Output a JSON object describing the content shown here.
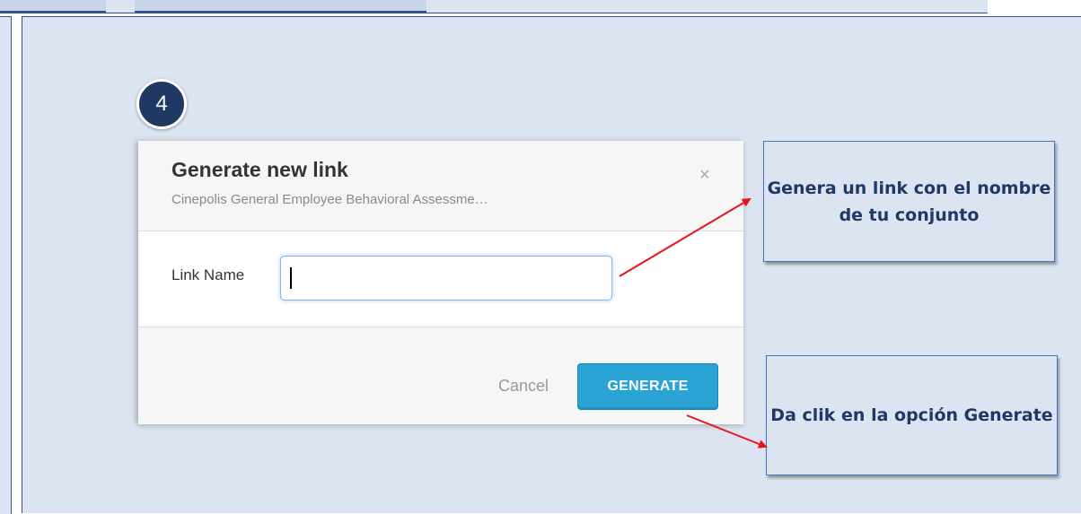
{
  "step_badge": "4",
  "dialog": {
    "title": "Generate new link",
    "subtitle": "Cinepolis General Employee Behavioral Assessme…",
    "close_symbol": "×",
    "link_name_label": "Link Name",
    "link_name_value": "",
    "cancel_label": "Cancel",
    "generate_label": "GENERATE"
  },
  "callouts": {
    "link_hint": "Genera un link con el nombre de tu conjunto",
    "generate_hint": "Da clik en la opción Generate"
  },
  "colors": {
    "panel_background": "#dbe4f0",
    "panel_border": "#2f5597",
    "badge": "#1f3864",
    "generate_button": "#2aa3d5",
    "arrow": "#e8141b"
  },
  "icons": {
    "close": "close-icon"
  }
}
